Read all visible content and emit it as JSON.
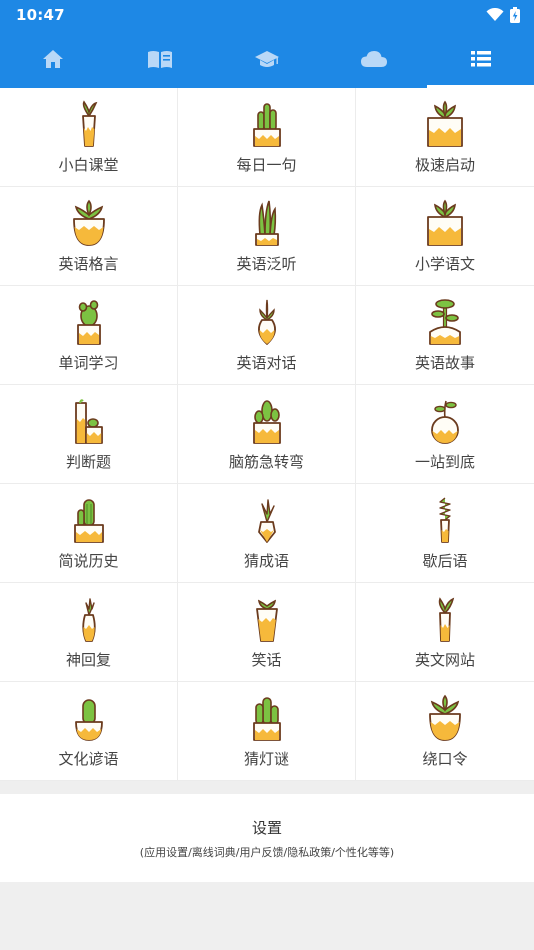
{
  "status_bar": {
    "time": "10:47",
    "icons": [
      "wifi-icon",
      "battery-charging-icon"
    ]
  },
  "tabs": [
    {
      "icon": "home-icon"
    },
    {
      "icon": "book-icon"
    },
    {
      "icon": "graduation-cap-icon"
    },
    {
      "icon": "cloud-icon"
    },
    {
      "icon": "list-icon",
      "active": true
    }
  ],
  "grid": [
    {
      "label": "小白课堂"
    },
    {
      "label": "每日一句"
    },
    {
      "label": "极速启动"
    },
    {
      "label": "英语格言"
    },
    {
      "label": "英语泛听"
    },
    {
      "label": "小学语文"
    },
    {
      "label": "单词学习"
    },
    {
      "label": "英语对话"
    },
    {
      "label": "英语故事"
    },
    {
      "label": "判断题"
    },
    {
      "label": "脑筋急转弯"
    },
    {
      "label": "一站到底"
    },
    {
      "label": "简说历史"
    },
    {
      "label": "猜成语"
    },
    {
      "label": "歇后语"
    },
    {
      "label": "神回复"
    },
    {
      "label": "笑话"
    },
    {
      "label": "英文网站"
    },
    {
      "label": "文化谚语"
    },
    {
      "label": "猜灯谜"
    },
    {
      "label": "绕口令"
    }
  ],
  "settings": {
    "title": "设置",
    "subtitle": "(应用设置/离线词典/用户反馈/隐私政策/个性化等等)"
  },
  "colors": {
    "primary": "#1e88e5",
    "tab_icon": "#b9d8f7",
    "plant_green": "#7cc242",
    "pot_yellow": "#f6b93b",
    "outline": "#6b3b1e"
  }
}
